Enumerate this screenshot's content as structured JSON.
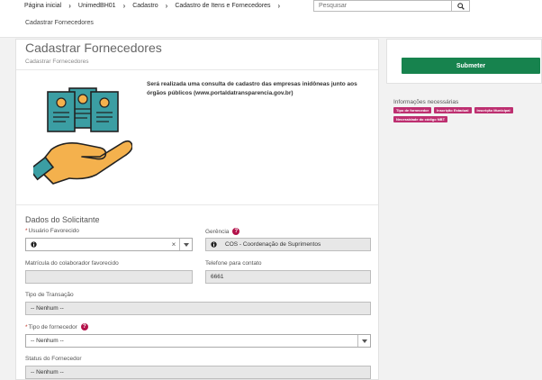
{
  "breadcrumb": [
    "Página inicial",
    "UnimedBH01",
    "Cadastro",
    "Cadastro de Itens e Fornecedores"
  ],
  "search": {
    "placeholder": "Pesquisar"
  },
  "subheader": {
    "title": "Cadastrar Fornecedores"
  },
  "form": {
    "title": "Cadastrar Fornecedores",
    "subtitle": "Cadastrar Fornecedores",
    "notice_line1": "Será realizada uma consulta de cadastro das empresas inidôneas junto aos órgãos",
    "notice_line2": "públicos ",
    "notice_link": "(www.portaldatransparencia.gov.br)",
    "section_title": "Dados do Solicitante",
    "fields": {
      "usuario_favorecido": {
        "label": "Usuário Favorecido",
        "value": ""
      },
      "gerencia": {
        "label": "Gerência",
        "value": "COS - Coordenação de Suprimentos"
      },
      "matricula": {
        "label": "Matrícula do colaborador favorecido",
        "value": ""
      },
      "telefone": {
        "label": "Telefone para contato",
        "value": "6661"
      },
      "tipo_transacao": {
        "label": "Tipo de Transação",
        "value": "-- Nenhum --"
      },
      "tipo_fornecedor": {
        "label": "Tipo de fornecedor",
        "value": "-- Nenhum --"
      },
      "status_fornecedor": {
        "label": "Status do Fornecedor",
        "value": "-- Nenhum --"
      }
    }
  },
  "sidebar": {
    "submit_label": "Submeter",
    "info_title": "Informações necessárias",
    "tags": [
      "Tipo de fornecedor",
      "Inscrição Estadual",
      "Inscrição Municipal",
      "Necessidade do código NBT"
    ]
  },
  "colors": {
    "primary_button": "#17834e",
    "tag": "#bd2f70",
    "help_icon": "#b3124a"
  }
}
